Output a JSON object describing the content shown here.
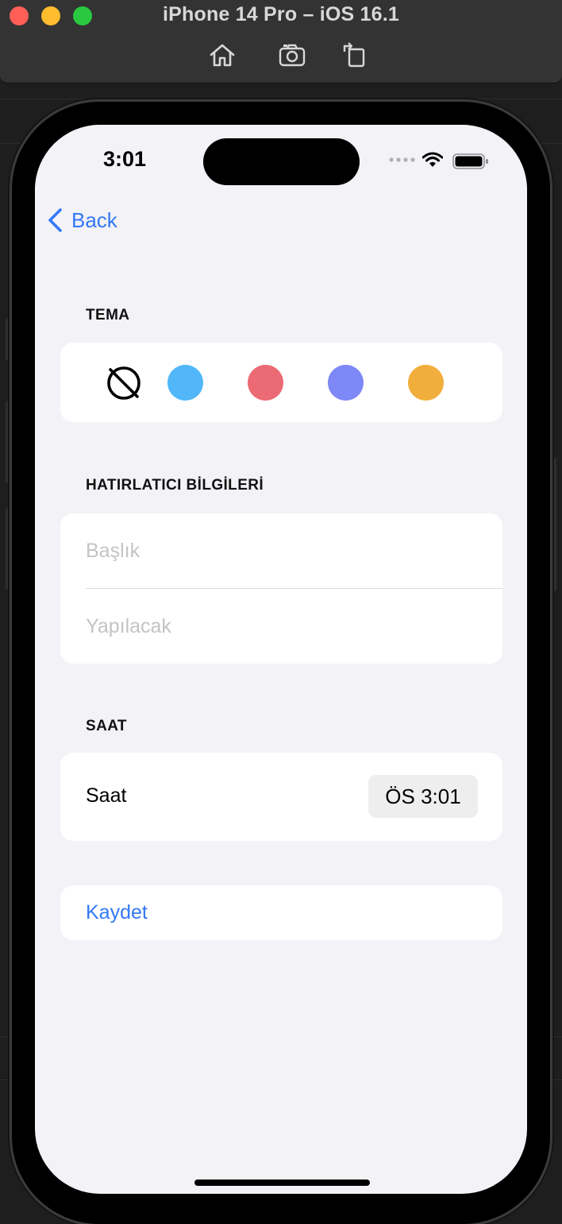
{
  "window": {
    "title": "iPhone 14 Pro – iOS 16.1",
    "toolbar_icons": [
      "home-icon",
      "screenshot-icon",
      "rotate-icon"
    ]
  },
  "status_bar": {
    "time": "3:01"
  },
  "nav": {
    "back_label": "Back"
  },
  "theme_section": {
    "header": "TEMA",
    "options": [
      {
        "name": "no-color-icon"
      },
      {
        "name": "blue",
        "color": "#51b7f9"
      },
      {
        "name": "red",
        "color": "#ec6a73"
      },
      {
        "name": "purple",
        "color": "#7e88f6"
      },
      {
        "name": "orange",
        "color": "#f2ae3c"
      }
    ]
  },
  "reminder_section": {
    "header": "HATIRLATICI BİLGİLERİ",
    "title_placeholder": "Başlık",
    "todo_placeholder": "Yapılacak"
  },
  "time_section": {
    "header": "SAAT",
    "label": "Saat",
    "value": "ÖS 3:01"
  },
  "actions": {
    "save_label": "Kaydet"
  },
  "colors": {
    "accent": "#3478f6",
    "background": "#f2f2f7",
    "card": "#ffffff"
  }
}
